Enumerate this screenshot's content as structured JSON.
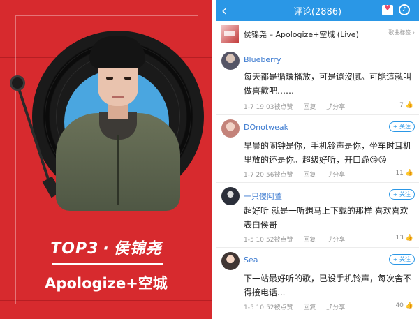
{
  "promo": {
    "top_label": "TOP3",
    "separator": "·",
    "artist": "侯锦尧",
    "song": "Apologize+空城"
  },
  "header": {
    "back_icon": "chevron-left-icon",
    "title": "评论(2886)",
    "icons": [
      "heart-share-icon",
      "music-disc-icon"
    ]
  },
  "song": {
    "title": "侯锦尧 – Apologize+空城 (Live)",
    "tag": "歌曲标签",
    "tag_arrow": "›"
  },
  "comments": [
    {
      "username": "Blueberry",
      "text": "每天都是循環播放，可是還沒膩。可能這就叫做喜歡吧……",
      "time": "1-7 19:03",
      "reply_label": "被点赞",
      "reply": "回复",
      "share": "分享",
      "likes": "7",
      "follow": null
    },
    {
      "username": "DOnotweak",
      "text": "早晨的闹钟是你，手机铃声是你，坐车时耳机里放的还是你。超级好听，开口跪😘😘",
      "time": "1-7 20:56",
      "reply_label": "被点赞",
      "reply": "回复",
      "share": "分享",
      "likes": "11",
      "follow": "+ 关注"
    },
    {
      "username": "一只傻阿萱",
      "text": "超好听  就是一听想马上下载的那样  喜欢喜欢表白侯哥",
      "time": "1-5 10:52",
      "reply_label": "被点赞",
      "reply": "回复",
      "share": "分享",
      "likes": "13",
      "follow": "+ 关注"
    },
    {
      "username": "Sea",
      "text": "下一站最好听的歌，已设手机铃声，每次舍不得接电话...",
      "time": "1-5 10:52",
      "reply_label": "被点赞",
      "reply": "回复",
      "share": "分享",
      "likes": "40",
      "follow": "+ 关注"
    }
  ],
  "colors": {
    "accent": "#2a97e6",
    "promo_bg": "#d72a2e",
    "username": "#3d7bd0"
  }
}
